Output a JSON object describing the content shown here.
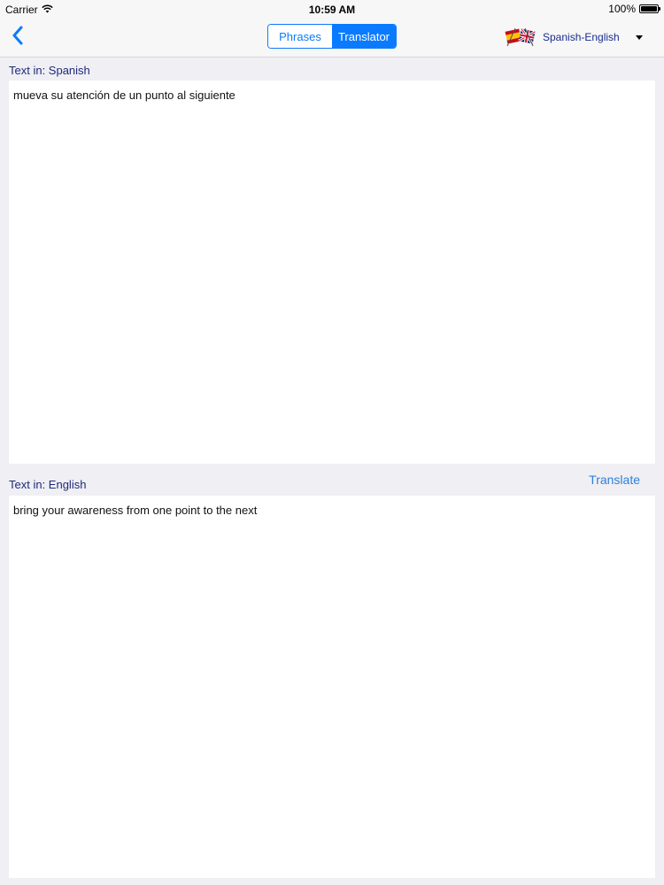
{
  "status_bar": {
    "carrier": "Carrier",
    "time": "10:59 AM",
    "battery": "100%",
    "battery_level": 1.0
  },
  "nav": {
    "back_icon": "chevron-left-icon",
    "segments": [
      {
        "label": "Phrases",
        "selected": false
      },
      {
        "label": "Translator",
        "selected": true
      }
    ],
    "language_pair": "Spanish-English",
    "flags_icon": "spain-uk-flags-icon"
  },
  "source": {
    "label": "Text in: Spanish",
    "text": "mueva su atención de un punto al siguiente"
  },
  "target": {
    "label": "Text in: English",
    "text": "bring your awareness from one point to the next",
    "translate_label": "Translate"
  },
  "colors": {
    "accent": "#0a7bff",
    "label_text": "#1f2a7a",
    "background": "#efeff4"
  }
}
